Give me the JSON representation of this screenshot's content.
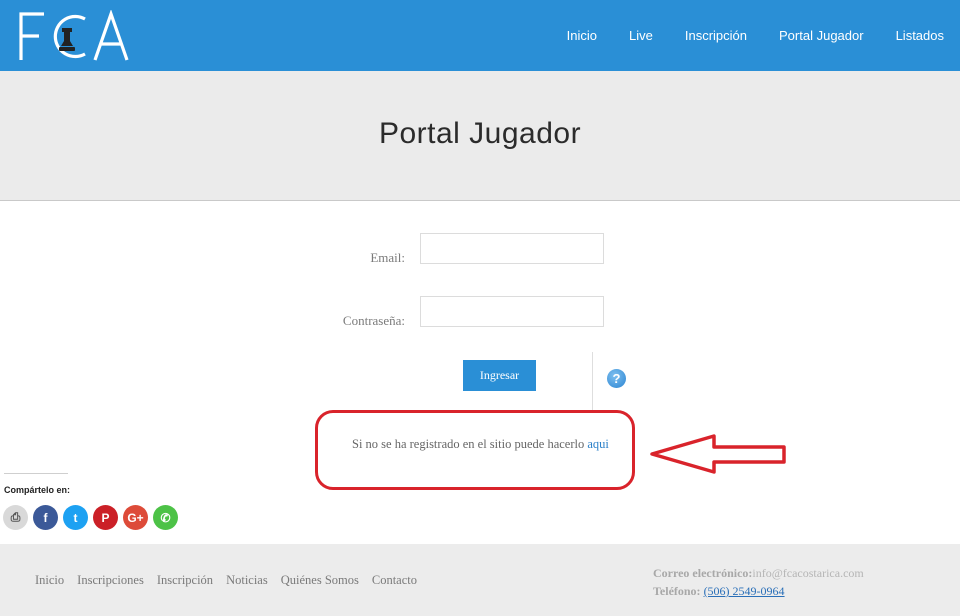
{
  "header": {
    "logo_text": "FCA",
    "nav": [
      "Inicio",
      "Live",
      "Inscripción",
      "Portal Jugador",
      "Listados"
    ],
    "color": "#2a8fd6"
  },
  "page": {
    "title": "Portal Jugador"
  },
  "form": {
    "email_label": "Email:",
    "password_label": "Contraseña:",
    "email_value": "",
    "password_value": "",
    "submit_label": "Ingresar",
    "help_icon": "question-circle-icon"
  },
  "register": {
    "text": "Si no se ha registrado en el sitio puede hacerlo",
    "link": "aqui"
  },
  "share": {
    "label": "Compártelo en:",
    "icons": [
      {
        "name": "print-icon",
        "glyph": "⎙",
        "color": "#d9d9d9"
      },
      {
        "name": "facebook-icon",
        "glyph": "f",
        "color": "#3b5998"
      },
      {
        "name": "twitter-icon",
        "glyph": "t",
        "color": "#1da1f2"
      },
      {
        "name": "pinterest-icon",
        "glyph": "P",
        "color": "#cb2027"
      },
      {
        "name": "google-plus-icon",
        "glyph": "G+",
        "color": "#dd4b39"
      },
      {
        "name": "whatsapp-icon",
        "glyph": "✆",
        "color": "#4dc247"
      }
    ]
  },
  "footer": {
    "nav": [
      "Inicio",
      "Inscripciones",
      "Inscripción",
      "Noticias",
      "Quiénes Somos",
      "Contacto"
    ],
    "email_label": "Correo electrónico:",
    "email_value": "info@fcacostarica.com",
    "phone_label": "Teléfono:",
    "phone_value": "(506) 2549-0964"
  },
  "annotation_color": "#d9232b"
}
